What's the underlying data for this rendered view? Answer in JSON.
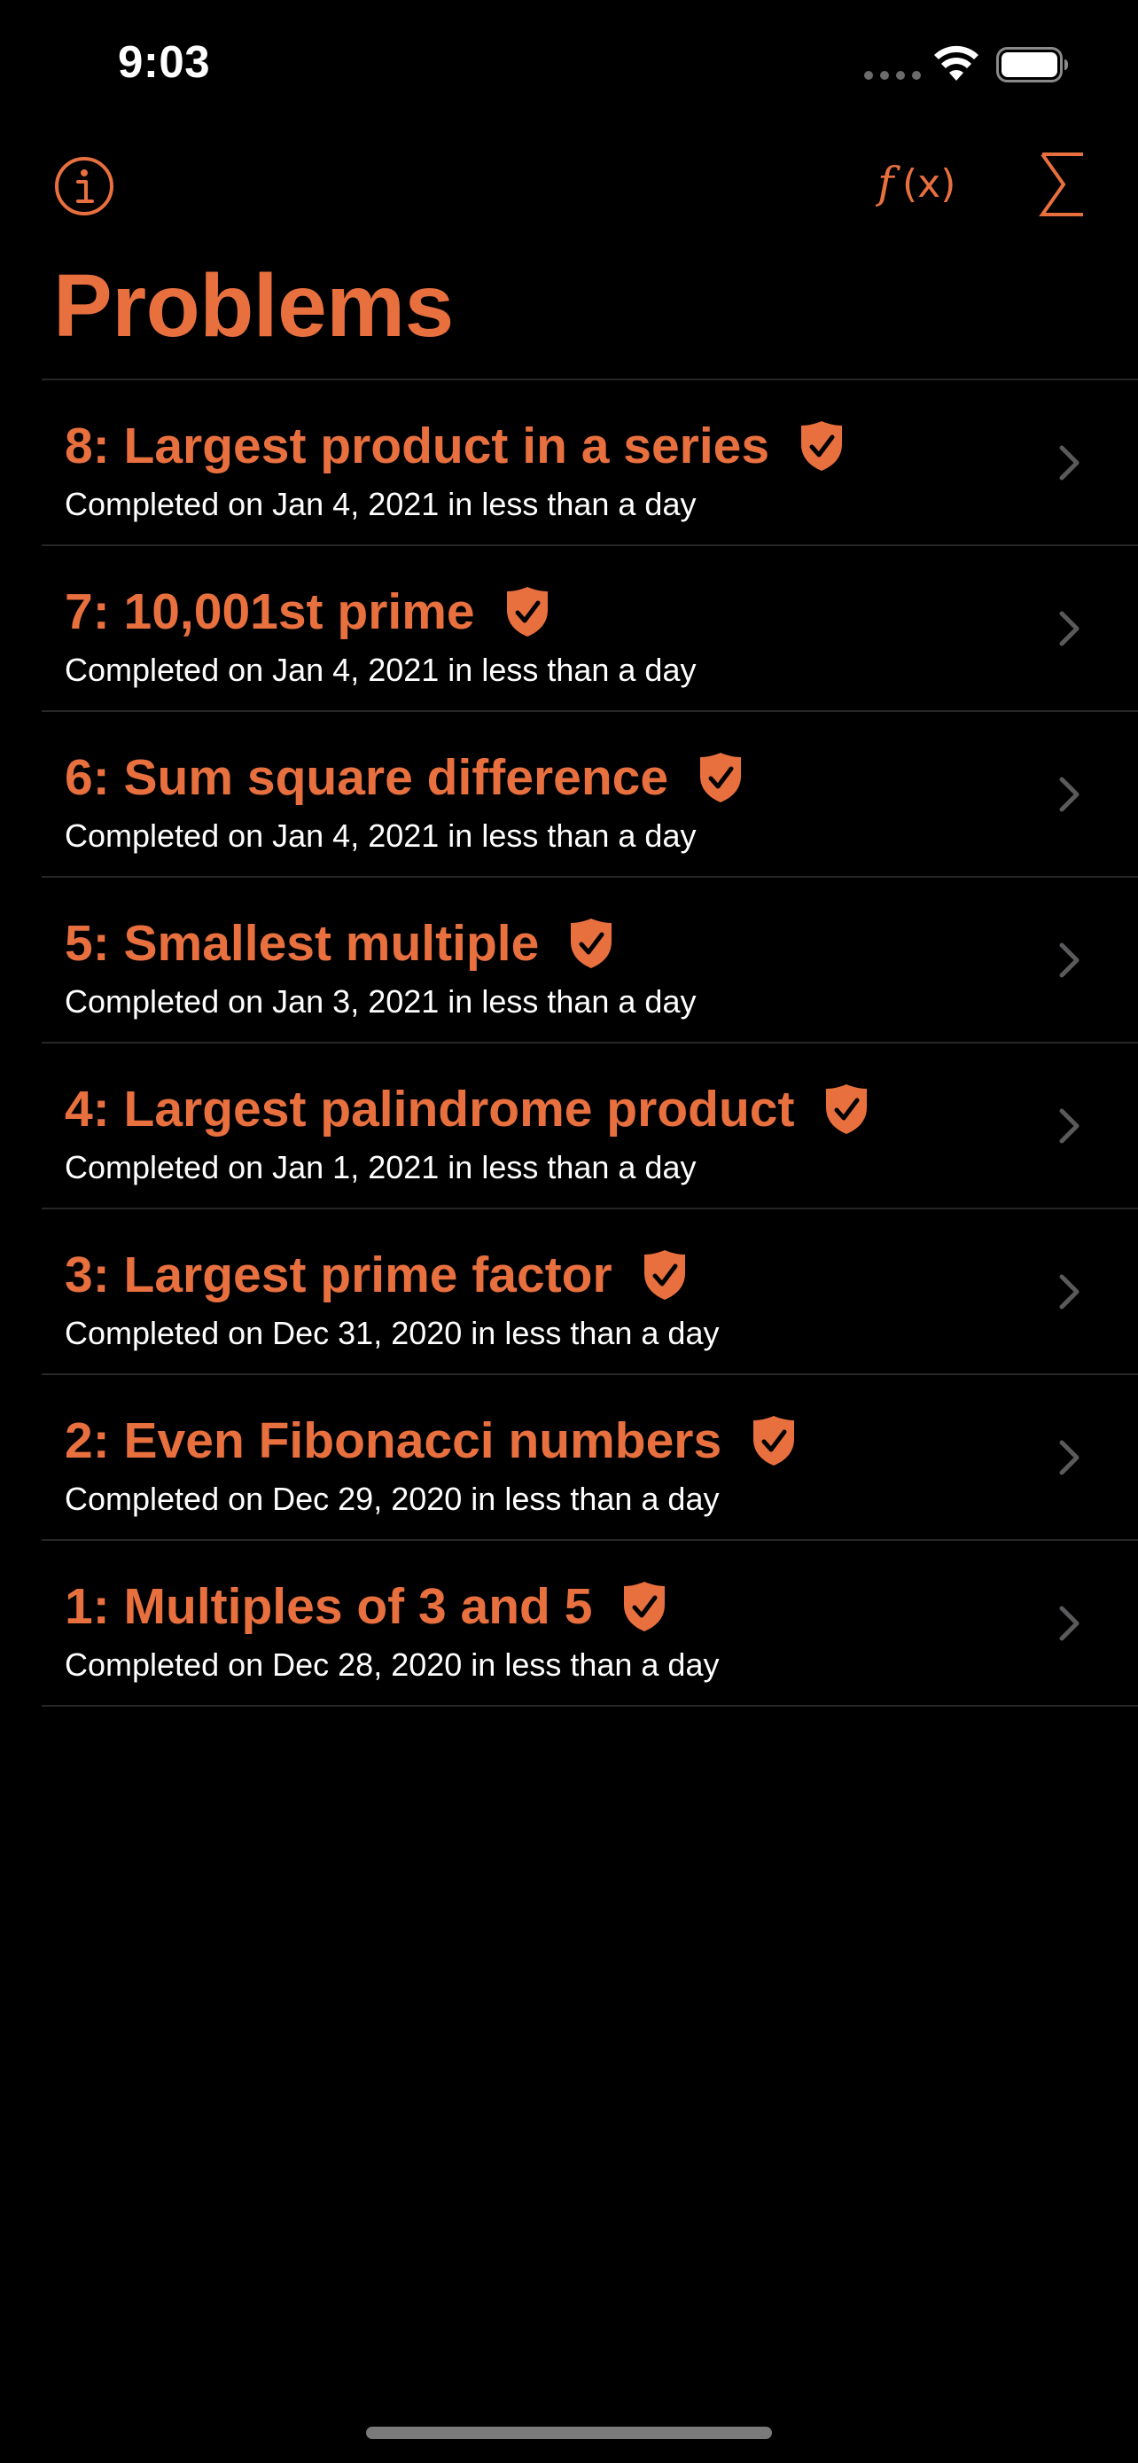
{
  "status_bar": {
    "time": "9:03"
  },
  "nav": {
    "info_icon": "info-circle-icon",
    "function_icon": "function-icon",
    "function_label": "ƒ(x)",
    "sum_icon": "sigma-icon",
    "sum_label": "∑",
    "title": "Problems"
  },
  "colors": {
    "accent": "#e8703f",
    "background": "#000000",
    "divider": "#262626",
    "chevron": "#5a5a5c"
  },
  "problems": [
    {
      "title": "8: Largest product in a series",
      "subtitle": "Completed on Jan 4, 2021 in less than a day",
      "badge_icon": "checkmark-shield-icon"
    },
    {
      "title": "7: 10,001st prime",
      "subtitle": "Completed on Jan 4, 2021 in less than a day",
      "badge_icon": "checkmark-shield-icon"
    },
    {
      "title": "6: Sum square difference",
      "subtitle": "Completed on Jan 4, 2021 in less than a day",
      "badge_icon": "checkmark-shield-icon"
    },
    {
      "title": "5: Smallest multiple",
      "subtitle": "Completed on Jan 3, 2021 in less than a day",
      "badge_icon": "checkmark-shield-icon"
    },
    {
      "title": "4: Largest palindrome product",
      "subtitle": "Completed on Jan 1, 2021 in less than a day",
      "badge_icon": "checkmark-shield-icon"
    },
    {
      "title": "3: Largest prime factor",
      "subtitle": "Completed on Dec 31, 2020 in less than a day",
      "badge_icon": "checkmark-shield-icon"
    },
    {
      "title": "2: Even Fibonacci numbers",
      "subtitle": "Completed on Dec 29, 2020 in less than a day",
      "badge_icon": "checkmark-shield-icon"
    },
    {
      "title": "1: Multiples of 3 and 5",
      "subtitle": "Completed on Dec 28, 2020 in less than a day",
      "badge_icon": "checkmark-shield-icon"
    }
  ]
}
